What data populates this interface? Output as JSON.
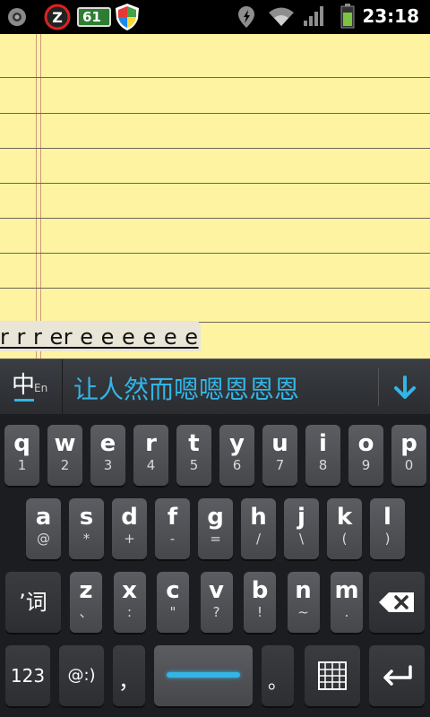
{
  "status_bar": {
    "time": "23:18",
    "badge": "61",
    "icons": [
      "settings-icon",
      "z-app-icon",
      "battery-61-icon",
      "shield-app-icon",
      "gps-icon",
      "wifi-icon",
      "signal-icon",
      "battery-icon"
    ]
  },
  "notepad": {
    "text": "r r r er e e e e e e"
  },
  "ime": {
    "mode_zh": "中",
    "mode_en": "En",
    "candidates": "让人然而嗯嗯恩恩恩",
    "accent": "#33b5e5"
  },
  "keyboard": {
    "row1": [
      {
        "main": "q",
        "sub": "1"
      },
      {
        "main": "w",
        "sub": "2"
      },
      {
        "main": "e",
        "sub": "3"
      },
      {
        "main": "r",
        "sub": "4"
      },
      {
        "main": "t",
        "sub": "5"
      },
      {
        "main": "y",
        "sub": "6"
      },
      {
        "main": "u",
        "sub": "7"
      },
      {
        "main": "i",
        "sub": "8"
      },
      {
        "main": "o",
        "sub": "9"
      },
      {
        "main": "p",
        "sub": "0"
      }
    ],
    "row2": [
      {
        "main": "a",
        "sub": "@"
      },
      {
        "main": "s",
        "sub": "*"
      },
      {
        "main": "d",
        "sub": "+"
      },
      {
        "main": "f",
        "sub": "-"
      },
      {
        "main": "g",
        "sub": "="
      },
      {
        "main": "h",
        "sub": "/"
      },
      {
        "main": "j",
        "sub": "\\"
      },
      {
        "main": "k",
        "sub": "("
      },
      {
        "main": "l",
        "sub": ")"
      }
    ],
    "row3": [
      {
        "main": "z",
        "sub": "、"
      },
      {
        "main": "x",
        "sub": ":"
      },
      {
        "main": "c",
        "sub": "\""
      },
      {
        "main": "v",
        "sub": "?"
      },
      {
        "main": "b",
        "sub": "!"
      },
      {
        "main": "n",
        "sub": "~"
      },
      {
        "main": "m",
        "sub": "."
      }
    ],
    "word_key": "’词",
    "num_key": "123",
    "emoji_key": "@:)",
    "comma_key": "，",
    "period_key": "。"
  }
}
